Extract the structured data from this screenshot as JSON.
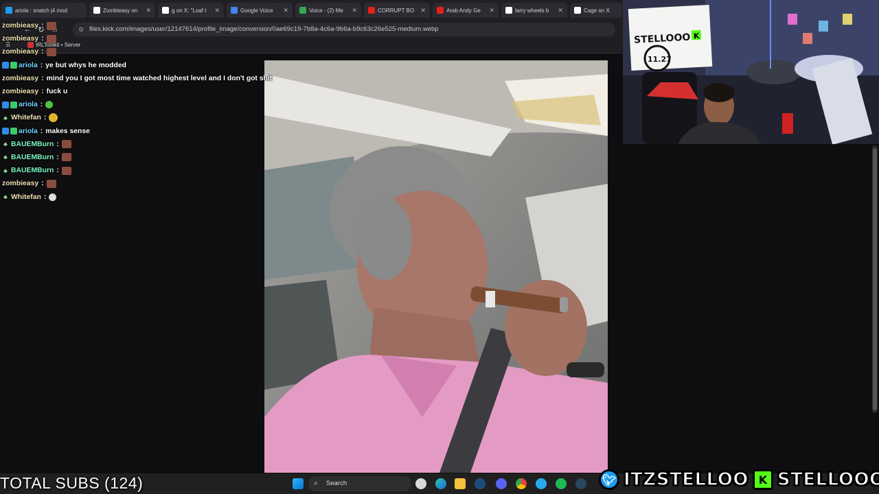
{
  "browser": {
    "tabs": [
      {
        "label": "ariola : snatch j4 mod",
        "color": "#1d9bf0"
      },
      {
        "label": "Zombieasy on",
        "color": "#ffffff"
      },
      {
        "label": "g on X: \"Loaf t",
        "color": "#ffffff"
      },
      {
        "label": "Google Voice",
        "color": "#4285f4"
      },
      {
        "label": "Voice - (2) Me",
        "color": "#34a853"
      },
      {
        "label": "CORRUPT BO",
        "color": "#e62117"
      },
      {
        "label": "Arab Andy Ge",
        "color": "#e62117"
      },
      {
        "label": "larry wheels b",
        "color": "#ffffff"
      },
      {
        "label": "Cage on X",
        "color": "#ffffff"
      }
    ],
    "url": "files.kick.com/images/user/12147614/profile_image/conversion/0ae69c19-7b8a-4c6a-9b6a-b9c63c26e525-medium.webp",
    "bookmark": "IRLToolkit • Server"
  },
  "chat": [
    {
      "user": "zombieasy",
      "text": "",
      "color": "#f0e3b4",
      "badge": "none",
      "emote": "brown"
    },
    {
      "user": "zombieasy",
      "text": "",
      "color": "#f0e3b4",
      "badge": "none",
      "emote": "brown"
    },
    {
      "user": "zombieasy",
      "text": "",
      "color": "#f0e3b4",
      "badge": "none",
      "emote": "brown"
    },
    {
      "user": "ariola",
      "text": "ye but whys he modded",
      "color": "#6fd3ff",
      "badge": "mod",
      "emote": ""
    },
    {
      "user": "zombieasy",
      "text": "mind you I got most time watched highest level and I don't got shit",
      "color": "#f0e3b4",
      "badge": "none",
      "emote": ""
    },
    {
      "user": "zombieasy",
      "text": "fuck u",
      "color": "#f0e3b4",
      "badge": "none",
      "emote": ""
    },
    {
      "user": "ariola",
      "text": "",
      "color": "#6fd3ff",
      "badge": "mod",
      "emote": "green"
    },
    {
      "user": "Whitefan",
      "text": "",
      "color": "#f0e3b4",
      "badge": "gift",
      "emote": "yellow"
    },
    {
      "user": "ariola",
      "text": "makes sense",
      "color": "#6fd3ff",
      "badge": "mod",
      "emote": ""
    },
    {
      "user": "BAUEMBurn",
      "text": "",
      "color": "#7ef7c4",
      "badge": "gift",
      "emote": "brown"
    },
    {
      "user": "BAUEMBurn",
      "text": "",
      "color": "#7ef7c4",
      "badge": "gift",
      "emote": "brown"
    },
    {
      "user": "BAUEMBurn",
      "text": "",
      "color": "#7ef7c4",
      "badge": "gift",
      "emote": "brown"
    },
    {
      "user": "zombieasy",
      "text": "",
      "color": "#f0e3b4",
      "badge": "none",
      "emote": "brown"
    },
    {
      "user": "Whitefan",
      "text": "",
      "color": "#f0e3b4",
      "badge": "gift",
      "emote": "white"
    }
  ],
  "overlay": {
    "total_subs": "TOTAL SUBS (124)",
    "twitter_handle": "ITZSTELLOO",
    "kick_handle": "STELLOOO",
    "kick_icon_letter": "K"
  },
  "webcam": {
    "sign_text": "STELLOOO",
    "sign_k": "K",
    "sign_number": "11.27"
  },
  "taskbar": {
    "search_label": "Search"
  },
  "icons": [
    "back-icon",
    "reload-icon",
    "home-icon",
    "tune-icon",
    "apps-icon",
    "windows-start-icon",
    "search-icon",
    "edge-icon",
    "file-explorer-icon",
    "steam-icon",
    "discord-icon",
    "chrome-icon",
    "telegram-icon",
    "spotify-icon",
    "twitter-icon",
    "kick-icon"
  ]
}
